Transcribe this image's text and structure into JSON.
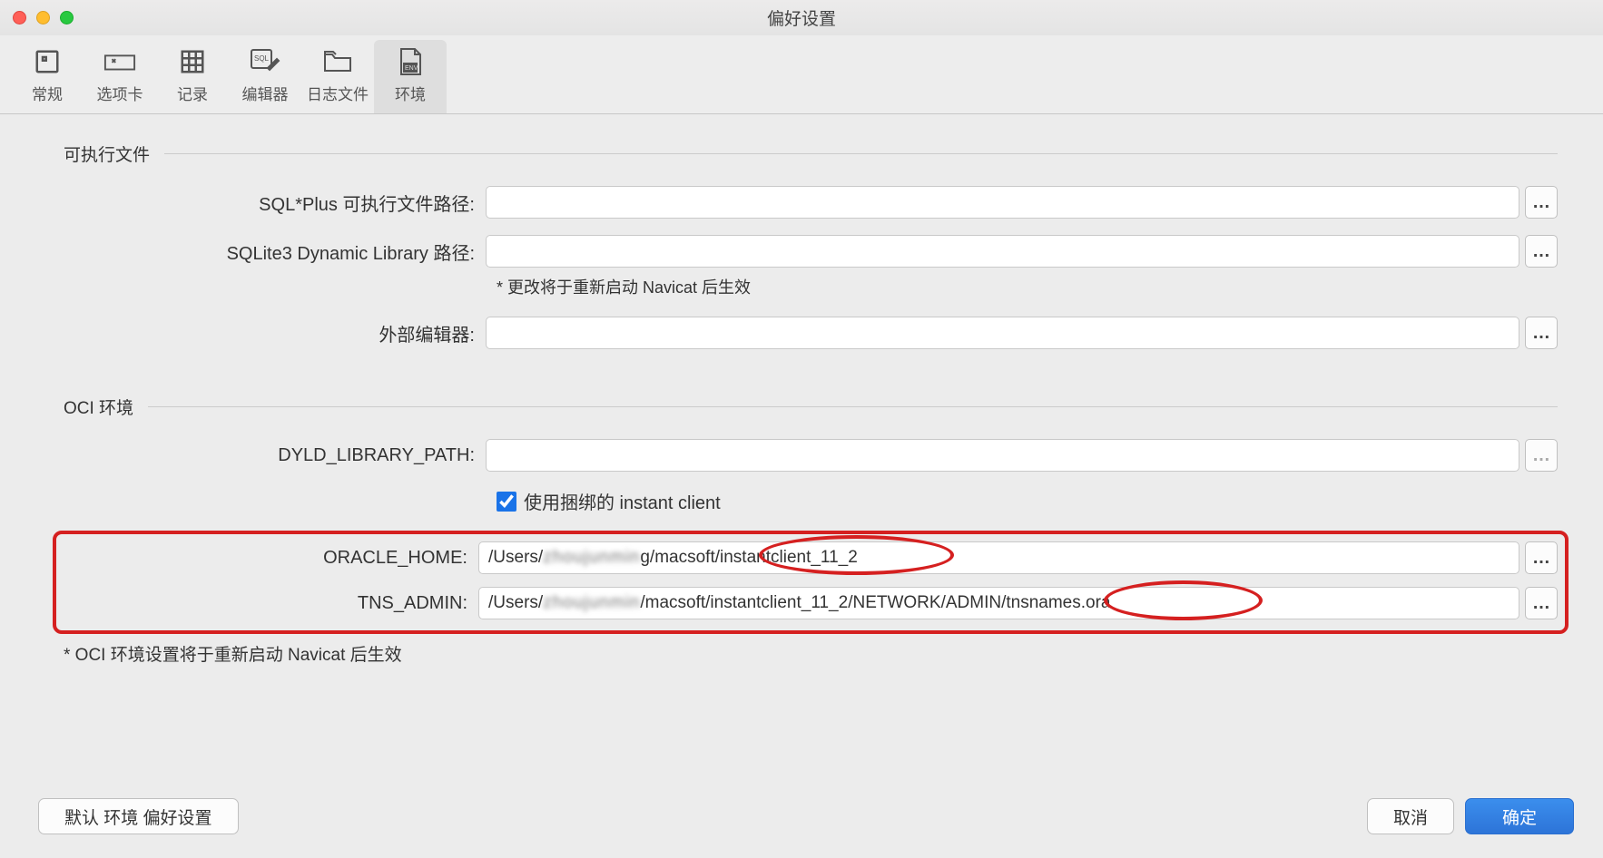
{
  "window_title": "偏好设置",
  "tabs": [
    {
      "key": "general",
      "label": "常规",
      "icon": "square-icon"
    },
    {
      "key": "tabs",
      "label": "选项卡",
      "icon": "tab-icon"
    },
    {
      "key": "records",
      "label": "记录",
      "icon": "grid-icon"
    },
    {
      "key": "editor",
      "label": "编辑器",
      "icon": "sql-edit-icon"
    },
    {
      "key": "logfiles",
      "label": "日志文件",
      "icon": "folder-icon"
    },
    {
      "key": "env",
      "label": "环境",
      "icon": "env-icon",
      "active": true
    }
  ],
  "section_exec": {
    "title": "可执行文件",
    "sqlplus_label": "SQL*Plus 可执行文件路径:",
    "sqlplus_value": "",
    "sqlite_label": "SQLite3 Dynamic Library 路径:",
    "sqlite_value": "",
    "sqlite_hint": "* 更改将于重新启动 Navicat 后生效",
    "external_editor_label": "外部编辑器:",
    "external_editor_value": ""
  },
  "section_oci": {
    "title": "OCI 环境",
    "dyld_label": "DYLD_LIBRARY_PATH:",
    "dyld_value": "",
    "use_bundled_label": "使用捆绑的 instant client",
    "use_bundled_checked": true,
    "oracle_home_label": "ORACLE_HOME:",
    "oracle_home_value_prefix": "/Users/",
    "oracle_home_value_obscured": "zhoujunmin",
    "oracle_home_value_mid": "g/macsoft/",
    "oracle_home_value_highlight": "instantclient_11_2",
    "tns_admin_label": "TNS_ADMIN:",
    "tns_admin_value_prefix": "/Users/",
    "tns_admin_value_obscured": "zhoujunmin",
    "tns_admin_value_mid": "/macsoft/instantclient_11_2/NETWORK/ADMIN/",
    "tns_admin_value_highlight": "tnsnames.ora",
    "oci_hint": "* OCI 环境设置将于重新启动 Navicat 后生效"
  },
  "footer": {
    "default_btn": "默认 环境 偏好设置",
    "cancel_btn": "取消",
    "ok_btn": "确定"
  },
  "browse_btn_label": "…"
}
